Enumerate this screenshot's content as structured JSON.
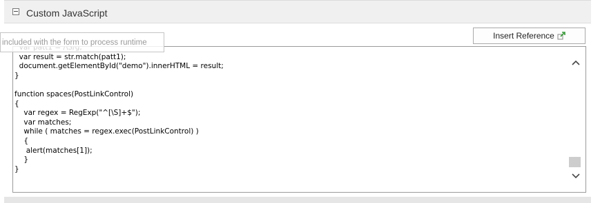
{
  "panel": {
    "title": "Custom JavaScript"
  },
  "toolbar": {
    "insert_reference_label": "Insert Reference",
    "insert_reference_icon": "insert-reference-icon"
  },
  "tooltip": {
    "text": "included with the form to process runtime"
  },
  "editor": {
    "code_lines": [
      "  var patt1 = /\\S/g;",
      "  var result = str.match(patt1);",
      "  document.getElementById(\"demo\").innerHTML = result;",
      "}",
      "",
      "function spaces(PostLinkControl)",
      "{",
      "    var regex = RegExp(\"^[\\S]+$\");",
      "    var matches;",
      "    while ( matches = regex.exec(PostLinkControl) )",
      "    {",
      "     alert(matches[1]);",
      "    }",
      "}"
    ]
  },
  "icons": {
    "collapse": "collapse-toggle-icon",
    "scroll_up": "chevron-up-icon",
    "scroll_down": "chevron-down-icon"
  },
  "colors": {
    "header_background": "#f0f0f0",
    "editor_border": "#9a9a9a",
    "reference_icon_green": "#3a9a3a"
  }
}
